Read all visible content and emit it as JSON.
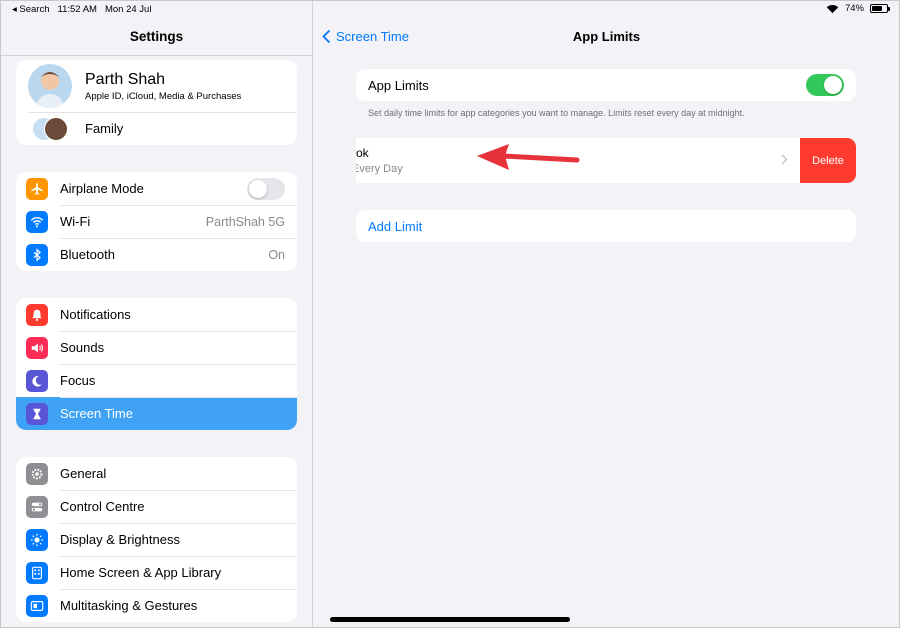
{
  "status_bar": {
    "back_label": "◂ Search",
    "time": "11:52 AM",
    "date": "Mon 24 Jul",
    "battery": "74%",
    "battery_level": 0.74
  },
  "sidebar": {
    "title": "Settings",
    "profile": {
      "name": "Parth Shah",
      "subtitle": "Apple ID, iCloud, Media & Purchases",
      "family_label": "Family"
    },
    "connectivity": [
      {
        "label": "Airplane Mode",
        "icon": "airplane-icon",
        "color": "#ff9500",
        "toggle": false
      },
      {
        "label": "Wi-Fi",
        "icon": "wifi-icon",
        "color": "#007aff",
        "value": "ParthShah 5G"
      },
      {
        "label": "Bluetooth",
        "icon": "bluetooth-icon",
        "color": "#007aff",
        "value": "On"
      }
    ],
    "notifications_group": [
      {
        "label": "Notifications",
        "icon": "bell-icon",
        "color": "#ff3b30"
      },
      {
        "label": "Sounds",
        "icon": "speaker-icon",
        "color": "#ff2d55"
      },
      {
        "label": "Focus",
        "icon": "moon-icon",
        "color": "#5856d6"
      },
      {
        "label": "Screen Time",
        "icon": "hourglass-icon",
        "color": "#5856d6",
        "selected": true
      }
    ],
    "general_group": [
      {
        "label": "General",
        "icon": "gear-icon",
        "color": "#8e8e93"
      },
      {
        "label": "Control Centre",
        "icon": "switches-icon",
        "color": "#8e8e93"
      },
      {
        "label": "Display & Brightness",
        "icon": "sun-icon",
        "color": "#007aff"
      },
      {
        "label": "Home Screen & App Library",
        "icon": "grid-icon",
        "color": "#007aff"
      },
      {
        "label": "Multitasking & Gestures",
        "icon": "multitask-icon",
        "color": "#007aff"
      }
    ]
  },
  "detail": {
    "back_label": "Screen Time",
    "title": "App Limits",
    "app_limits_toggle": {
      "label": "App Limits",
      "on": true
    },
    "footnote": "Set daily time limits for app categories you want to manage. Limits reset every day at midnight.",
    "limit_item": {
      "name": "ok",
      "schedule": "Every Day",
      "delete_label": "Delete"
    },
    "add_limit_label": "Add Limit"
  },
  "colors": {
    "accent": "#007aff",
    "selected_row": "#3fa2f4",
    "toggle_on": "#34c759",
    "delete": "#ff3b30",
    "annotation_arrow": "#e8323a"
  }
}
